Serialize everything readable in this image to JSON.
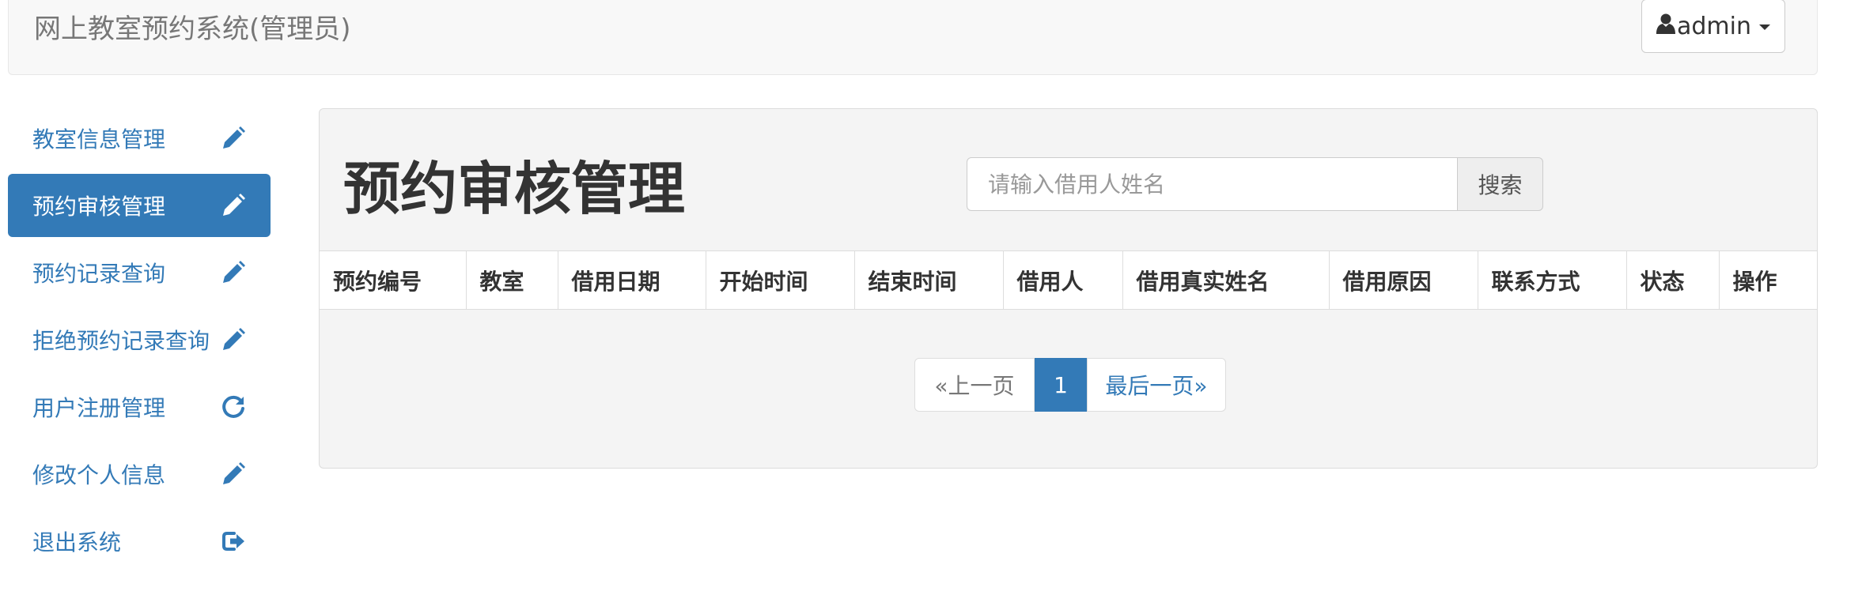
{
  "header": {
    "brand": "网上教室预约系统(管理员)",
    "user_label": "admin"
  },
  "sidebar": {
    "items": [
      {
        "label": "教室信息管理",
        "icon": "pencil-icon",
        "active": false
      },
      {
        "label": "预约审核管理",
        "icon": "pencil-icon",
        "active": true
      },
      {
        "label": "预约记录查询",
        "icon": "pencil-icon",
        "active": false
      },
      {
        "label": "拒绝预约记录查询",
        "icon": "pencil-icon",
        "active": false
      },
      {
        "label": "用户注册管理",
        "icon": "refresh-icon",
        "active": false
      },
      {
        "label": "修改个人信息",
        "icon": "pencil-icon",
        "active": false
      },
      {
        "label": "退出系统",
        "icon": "logout-icon",
        "active": false
      }
    ]
  },
  "main": {
    "title": "预约审核管理",
    "search": {
      "placeholder": "请输入借用人姓名",
      "value": "",
      "button_label": "搜索"
    },
    "table": {
      "columns": [
        "预约编号",
        "教室",
        "借用日期",
        "开始时间",
        "结束时间",
        "借用人",
        "借用真实姓名",
        "借用原因",
        "联系方式",
        "状态",
        "操作"
      ],
      "rows": []
    },
    "pagination": {
      "prev_label": "«上一页",
      "current_page": "1",
      "last_label": "最后一页»"
    }
  },
  "colors": {
    "primary": "#337ab7",
    "navbar_bg": "#f8f8f8",
    "panel_bg": "#f4f4f4"
  }
}
